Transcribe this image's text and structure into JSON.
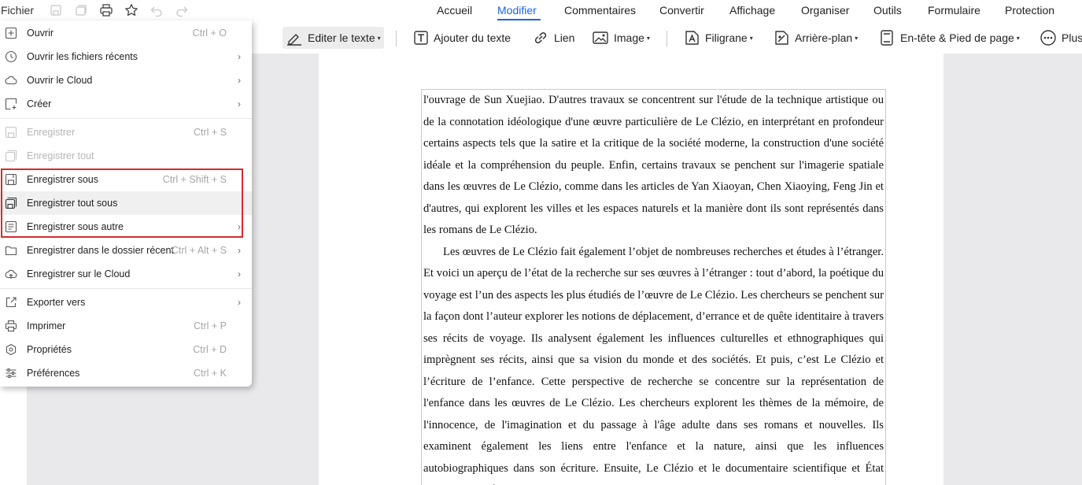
{
  "topbar": {
    "file_menu": "Fichier",
    "tabs": [
      "Accueil",
      "Modifier",
      "Commentaires",
      "Convertir",
      "Affichage",
      "Organiser",
      "Outils",
      "Formulaire",
      "Protection"
    ],
    "active_tab": "Modifier"
  },
  "toolbar": {
    "edit_text": "Editer le texte",
    "add_text": "Ajouter du texte",
    "link": "Lien",
    "image": "Image",
    "watermark": "Filigrane",
    "background": "Arrière-plan",
    "header_footer": "En-tête & Pied de page",
    "more": "Plus"
  },
  "menu": {
    "items": [
      {
        "label": "Ouvrir",
        "shortcut": "Ctrl + O",
        "arrow": ""
      },
      {
        "label": "Ouvrir les fichiers récents",
        "shortcut": "",
        "arrow": "›"
      },
      {
        "label": "Ouvrir le Cloud",
        "shortcut": "",
        "arrow": "›"
      },
      {
        "label": "Créer",
        "shortcut": "",
        "arrow": "›"
      },
      {
        "label": "Enregistrer",
        "shortcut": "Ctrl + S",
        "arrow": ""
      },
      {
        "label": "Enregistrer tout",
        "shortcut": "",
        "arrow": ""
      },
      {
        "label": "Enregistrer sous",
        "shortcut": "Ctrl + Shift + S",
        "arrow": ""
      },
      {
        "label": "Enregistrer tout sous",
        "shortcut": "",
        "arrow": ""
      },
      {
        "label": "Enregistrer sous autre",
        "shortcut": "",
        "arrow": "›"
      },
      {
        "label": "Enregistrer dans le dossier récent",
        "shortcut": "Ctrl + Alt + S",
        "arrow": "›"
      },
      {
        "label": "Enregistrer sur le Cloud",
        "shortcut": "",
        "arrow": "›"
      },
      {
        "label": "Exporter vers",
        "shortcut": "",
        "arrow": "›"
      },
      {
        "label": "Imprimer",
        "shortcut": "Ctrl + P",
        "arrow": ""
      },
      {
        "label": "Propriétés",
        "shortcut": "Ctrl + D",
        "arrow": ""
      },
      {
        "label": "Préférences",
        "shortcut": "Ctrl + K",
        "arrow": ""
      }
    ]
  },
  "document": {
    "paragraphs": [
      "l'ouvrage de Sun Xuejiao. D'autres travaux se concentrent sur l'étude de la technique artistique ou de la connotation idéologique d'une œuvre particulière de Le Clézio, en interprétant en profondeur certains aspects tels que la satire et la critique de la société moderne, la construction d'une société idéale et la compréhension du peuple. Enfin, certains travaux se penchent sur l'imagerie spatiale dans les œuvres de Le Clézio, comme dans les articles de Yan Xiaoyan, Chen Xiaoying, Feng Jin et d'autres, qui explorent les villes et les espaces naturels et la manière dont ils sont représentés dans les romans de Le Clézio.",
      "Les œuvres de Le Clézio fait également l’objet de nombreuses recherches et études à l’étranger. Et voici un aperçu de l’état de la recherche sur ses œuvres à l’étranger : tout d’abord, la poétique du voyage est l’un des aspects les plus étudiés de l’œuvre de Le Clézio. Les chercheurs se penchent sur la façon dont l’auteur explorer les notions de déplacement, d’errance et de quête identitaire à travers ses récits de voyage. Ils analysent également les influences culturelles et ethnographiques qui imprègnent ses récits, ainsi que sa vision du monde et des sociétés. Et puis, c’est Le Clézio et l’écriture de l’enfance. Cette perspective de recherche se concentre sur la représentation de l'enfance dans les œuvres de Le Clézio. Les chercheurs explorent les thèmes de la mémoire, de l'innocence, de l'imagination et du passage à l'âge adulte dans ses romans et nouvelles. Ils examinent également les liens entre l'enfance et la nature, ainsi que les influences autobiographiques dans son écriture. Ensuite, Le Clézio et le documentaire scientifique et État culturel, Le Clézio a souvent"
    ]
  }
}
